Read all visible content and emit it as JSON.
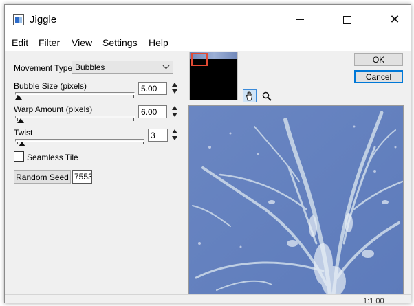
{
  "window": {
    "title": "Jiggle",
    "close_glyph": "✕"
  },
  "menu": [
    "Edit",
    "Filter",
    "View",
    "Settings",
    "Help"
  ],
  "controls": {
    "movement_type_label": "Movement Type:",
    "movement_type_value": "Bubbles",
    "bubble_size_label": "Bubble Size (pixels)",
    "bubble_size_value": "5.00",
    "warp_amount_label": "Warp Amount (pixels)",
    "warp_amount_value": "6.00",
    "twist_label": "Twist",
    "twist_value": "3",
    "seamless_tile_label": "Seamless Tile",
    "random_seed_label": "Random Seed",
    "random_seed_value": "7553"
  },
  "buttons": {
    "ok": "OK",
    "cancel": "Cancel"
  },
  "status": {
    "text": "1:1 00"
  },
  "icons": {
    "hand_tool": "hand-icon",
    "zoom_tool": "magnifier-icon",
    "app": "app-icon"
  },
  "colors": {
    "accent": "#0078d7",
    "nav_rect": "#e34a33",
    "preview_blue": "#6e8bc4"
  }
}
